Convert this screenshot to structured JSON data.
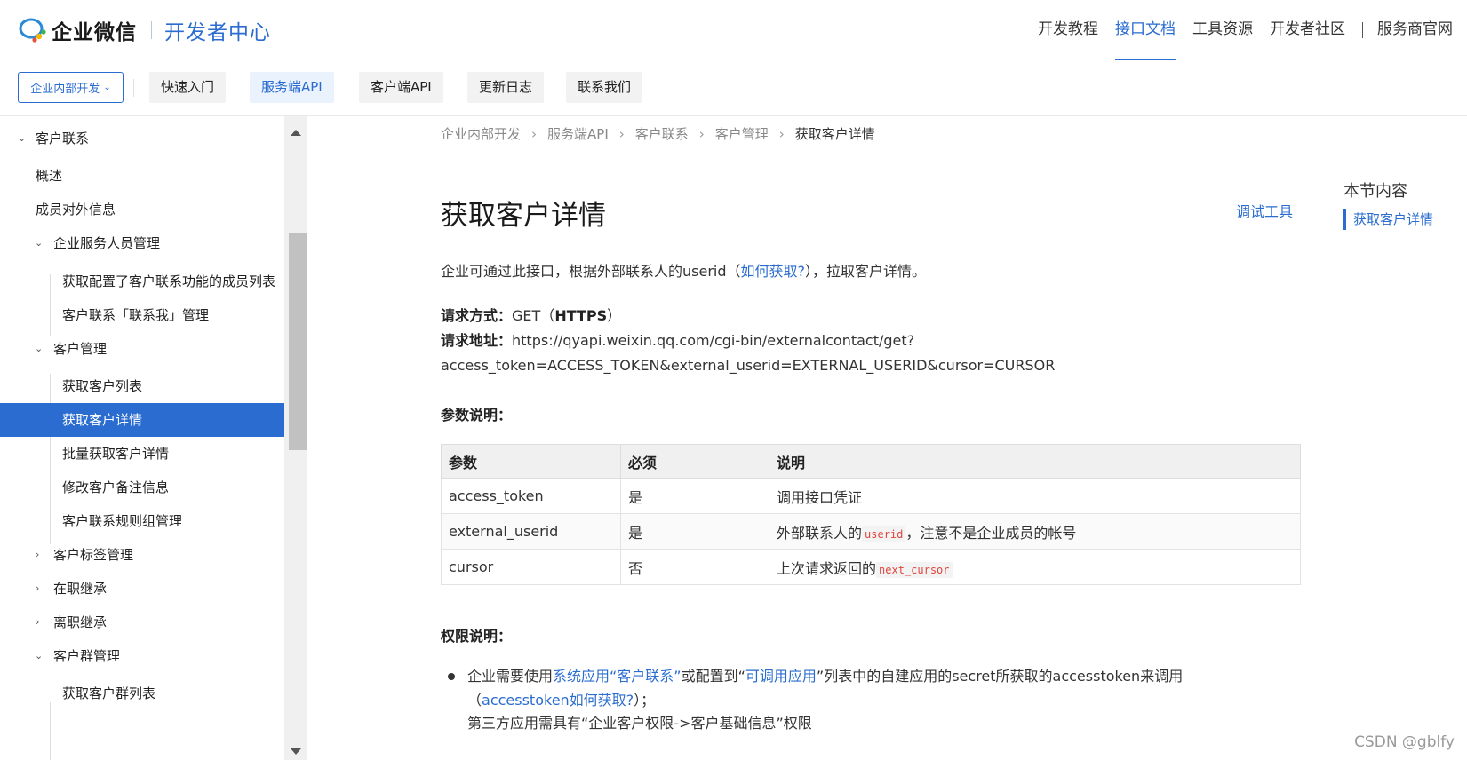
{
  "header": {
    "brand": "企业微信",
    "subtitle": "开发者中心",
    "nav": [
      "开发教程",
      "接口文档",
      "工具资源",
      "开发者社区",
      "服务商官网"
    ],
    "nav_active": "接口文档"
  },
  "subnav": {
    "scope": "企业内部开发",
    "tabs": [
      "快速入门",
      "服务端API",
      "客户端API",
      "更新日志",
      "联系我们"
    ],
    "active_tab": "服务端API"
  },
  "sidebar": {
    "items": [
      {
        "label": "客户联系",
        "caret": "v"
      },
      {
        "label": "概述"
      },
      {
        "label": "成员对外信息"
      },
      {
        "label": "企业服务人员管理",
        "caret": "v"
      },
      {
        "label": "获取配置了客户联系功能的成员列表"
      },
      {
        "label": "客户联系「联系我」管理"
      },
      {
        "label": "客户管理",
        "caret": "v"
      },
      {
        "label": "获取客户列表"
      },
      {
        "label": "获取客户详情"
      },
      {
        "label": "批量获取客户详情"
      },
      {
        "label": "修改客户备注信息"
      },
      {
        "label": "客户联系规则组管理"
      },
      {
        "label": "客户标签管理",
        "caret": ">"
      },
      {
        "label": "在职继承",
        "caret": ">"
      },
      {
        "label": "离职继承",
        "caret": ">"
      },
      {
        "label": "客户群管理",
        "caret": "v"
      },
      {
        "label": "获取客户群列表"
      }
    ],
    "active": "获取客户详情"
  },
  "breadcrumb": [
    "企业内部开发",
    "服务端API",
    "客户联系",
    "客户管理",
    "获取客户详情"
  ],
  "page": {
    "title": "获取客户详情",
    "debug_tool": "调试工具",
    "toc_title": "本节内容",
    "toc_item": "获取客户详情",
    "intro_prefix": "企业可通过此接口，根据外部联系人的userid（",
    "intro_link": "如何获取?",
    "intro_suffix": "），拉取客户详情。",
    "method_label": "请求方式：",
    "method_value": "GET（",
    "method_proto": "HTTPS",
    "method_close": "）",
    "url_label": "请求地址：",
    "url_line1": "https://qyapi.weixin.qq.com/cgi-bin/externalcontact/get?",
    "url_line2": "access_token=ACCESS_TOKEN&external_userid=EXTERNAL_USERID&cursor=CURSOR",
    "params_title": "参数说明：",
    "perm_title": "权限说明：",
    "perm1_a": "企业需要使用",
    "perm1_link1": "系统应用“客户联系”",
    "perm1_b": "或配置到“",
    "perm1_link2": "可调用应用",
    "perm1_c": "”列表中的自建应用的secret所获取的accesstoken来调用",
    "perm1_d": "（",
    "perm1_link3": "accesstoken如何获取?",
    "perm1_e": "）；",
    "perm2": "第三方应用需具有“企业客户权限->客户基础信息”权限"
  },
  "params_table": {
    "headers": [
      "参数",
      "必须",
      "说明"
    ],
    "rows": [
      {
        "name": "access_token",
        "required": "是",
        "desc": "调用接口凭证",
        "code": ""
      },
      {
        "name": "external_userid",
        "required": "是",
        "desc_pre": "外部联系人的",
        "code": "userid",
        "desc_post": "，注意不是企业成员的帐号"
      },
      {
        "name": "cursor",
        "required": "否",
        "desc_pre": "上次请求返回的",
        "code": "next_cursor",
        "desc_post": ""
      }
    ]
  },
  "watermark": "CSDN @gblfy",
  "colors": {
    "accent": "#2a6ccf",
    "code": "#e1453d"
  }
}
